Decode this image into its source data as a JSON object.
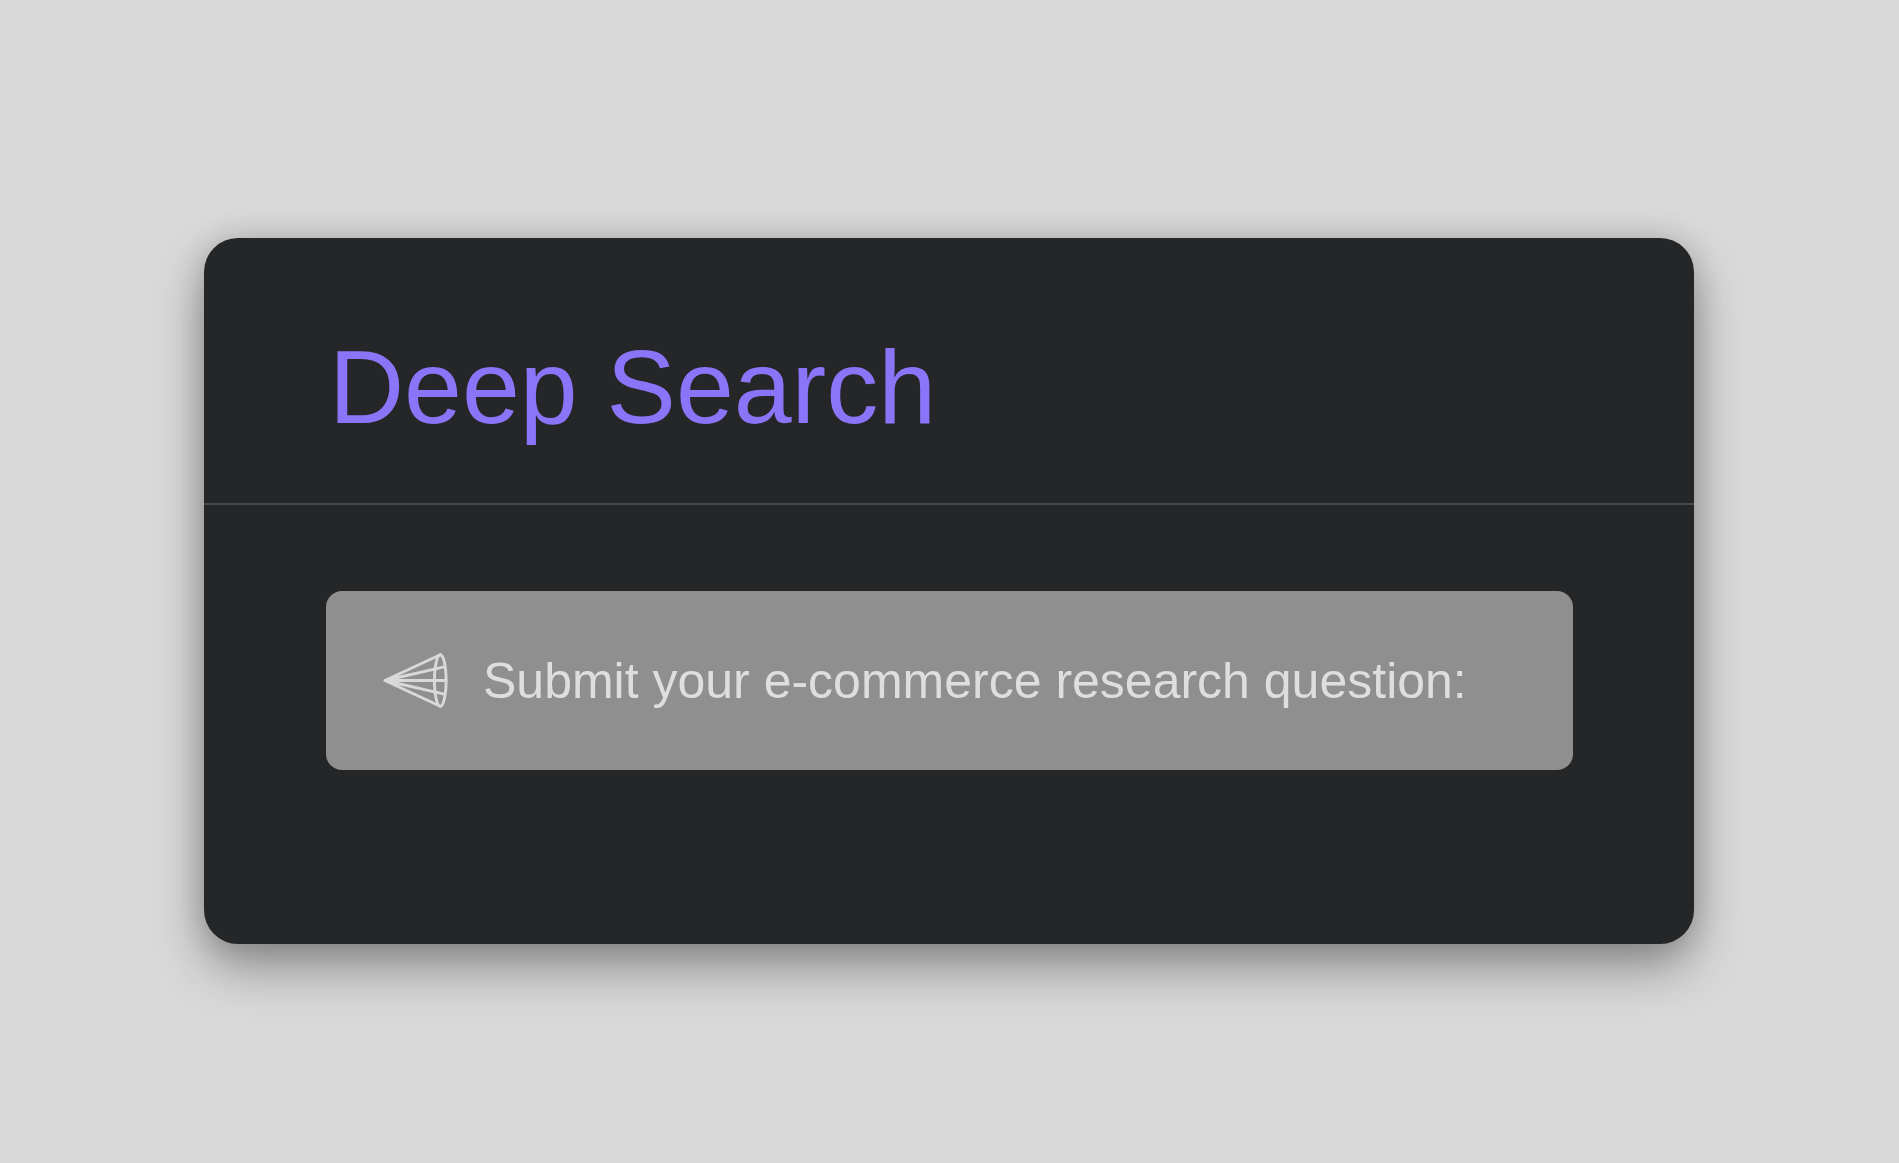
{
  "card": {
    "title": "Deep Search",
    "question_field": {
      "placeholder": "Submit your e-commerce research question:"
    }
  }
}
